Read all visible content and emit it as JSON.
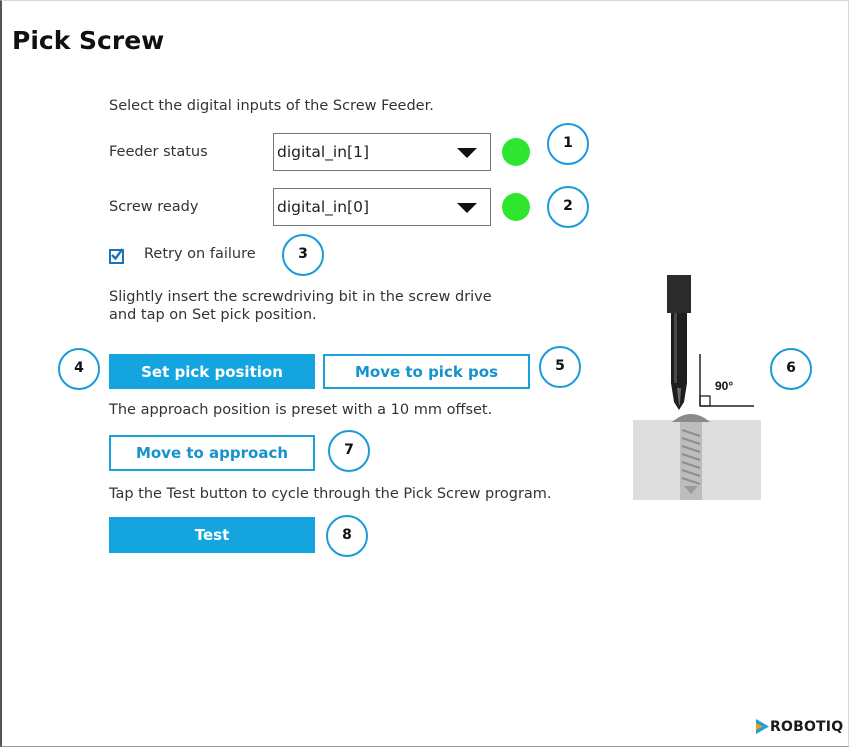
{
  "page": {
    "title": "Pick Screw"
  },
  "instructions": {
    "select_inputs": "Select the digital inputs of the Screw Feeder.",
    "insert_line1": "Slightly insert the screwdriving bit in the screw drive",
    "insert_line2": "and tap on Set pick position.",
    "approach_note": "The approach position is preset with a 10 mm offset.",
    "test_note": "Tap the Test button to cycle through the Pick Screw program."
  },
  "feeder_status": {
    "label": "Feeder status",
    "value": "digital_in[1]",
    "led_color": "#2ee62e"
  },
  "screw_ready": {
    "label": "Screw ready",
    "value": "digital_in[0]",
    "led_color": "#2ee62e"
  },
  "retry": {
    "label": "Retry on failure",
    "checked": true
  },
  "buttons": {
    "set_pick": "Set pick position",
    "move_pick": "Move to pick pos",
    "move_approach": "Move to approach",
    "test": "Test"
  },
  "callouts": [
    "1",
    "2",
    "3",
    "4",
    "5",
    "6",
    "7",
    "8"
  ],
  "illustration": {
    "angle_label": "90°"
  },
  "brand": {
    "logo_text": "ROBOTIQ"
  },
  "colors": {
    "accent": "#14a4df",
    "callout_ring": "#1a9bd7",
    "status_ok": "#2ee62e"
  }
}
